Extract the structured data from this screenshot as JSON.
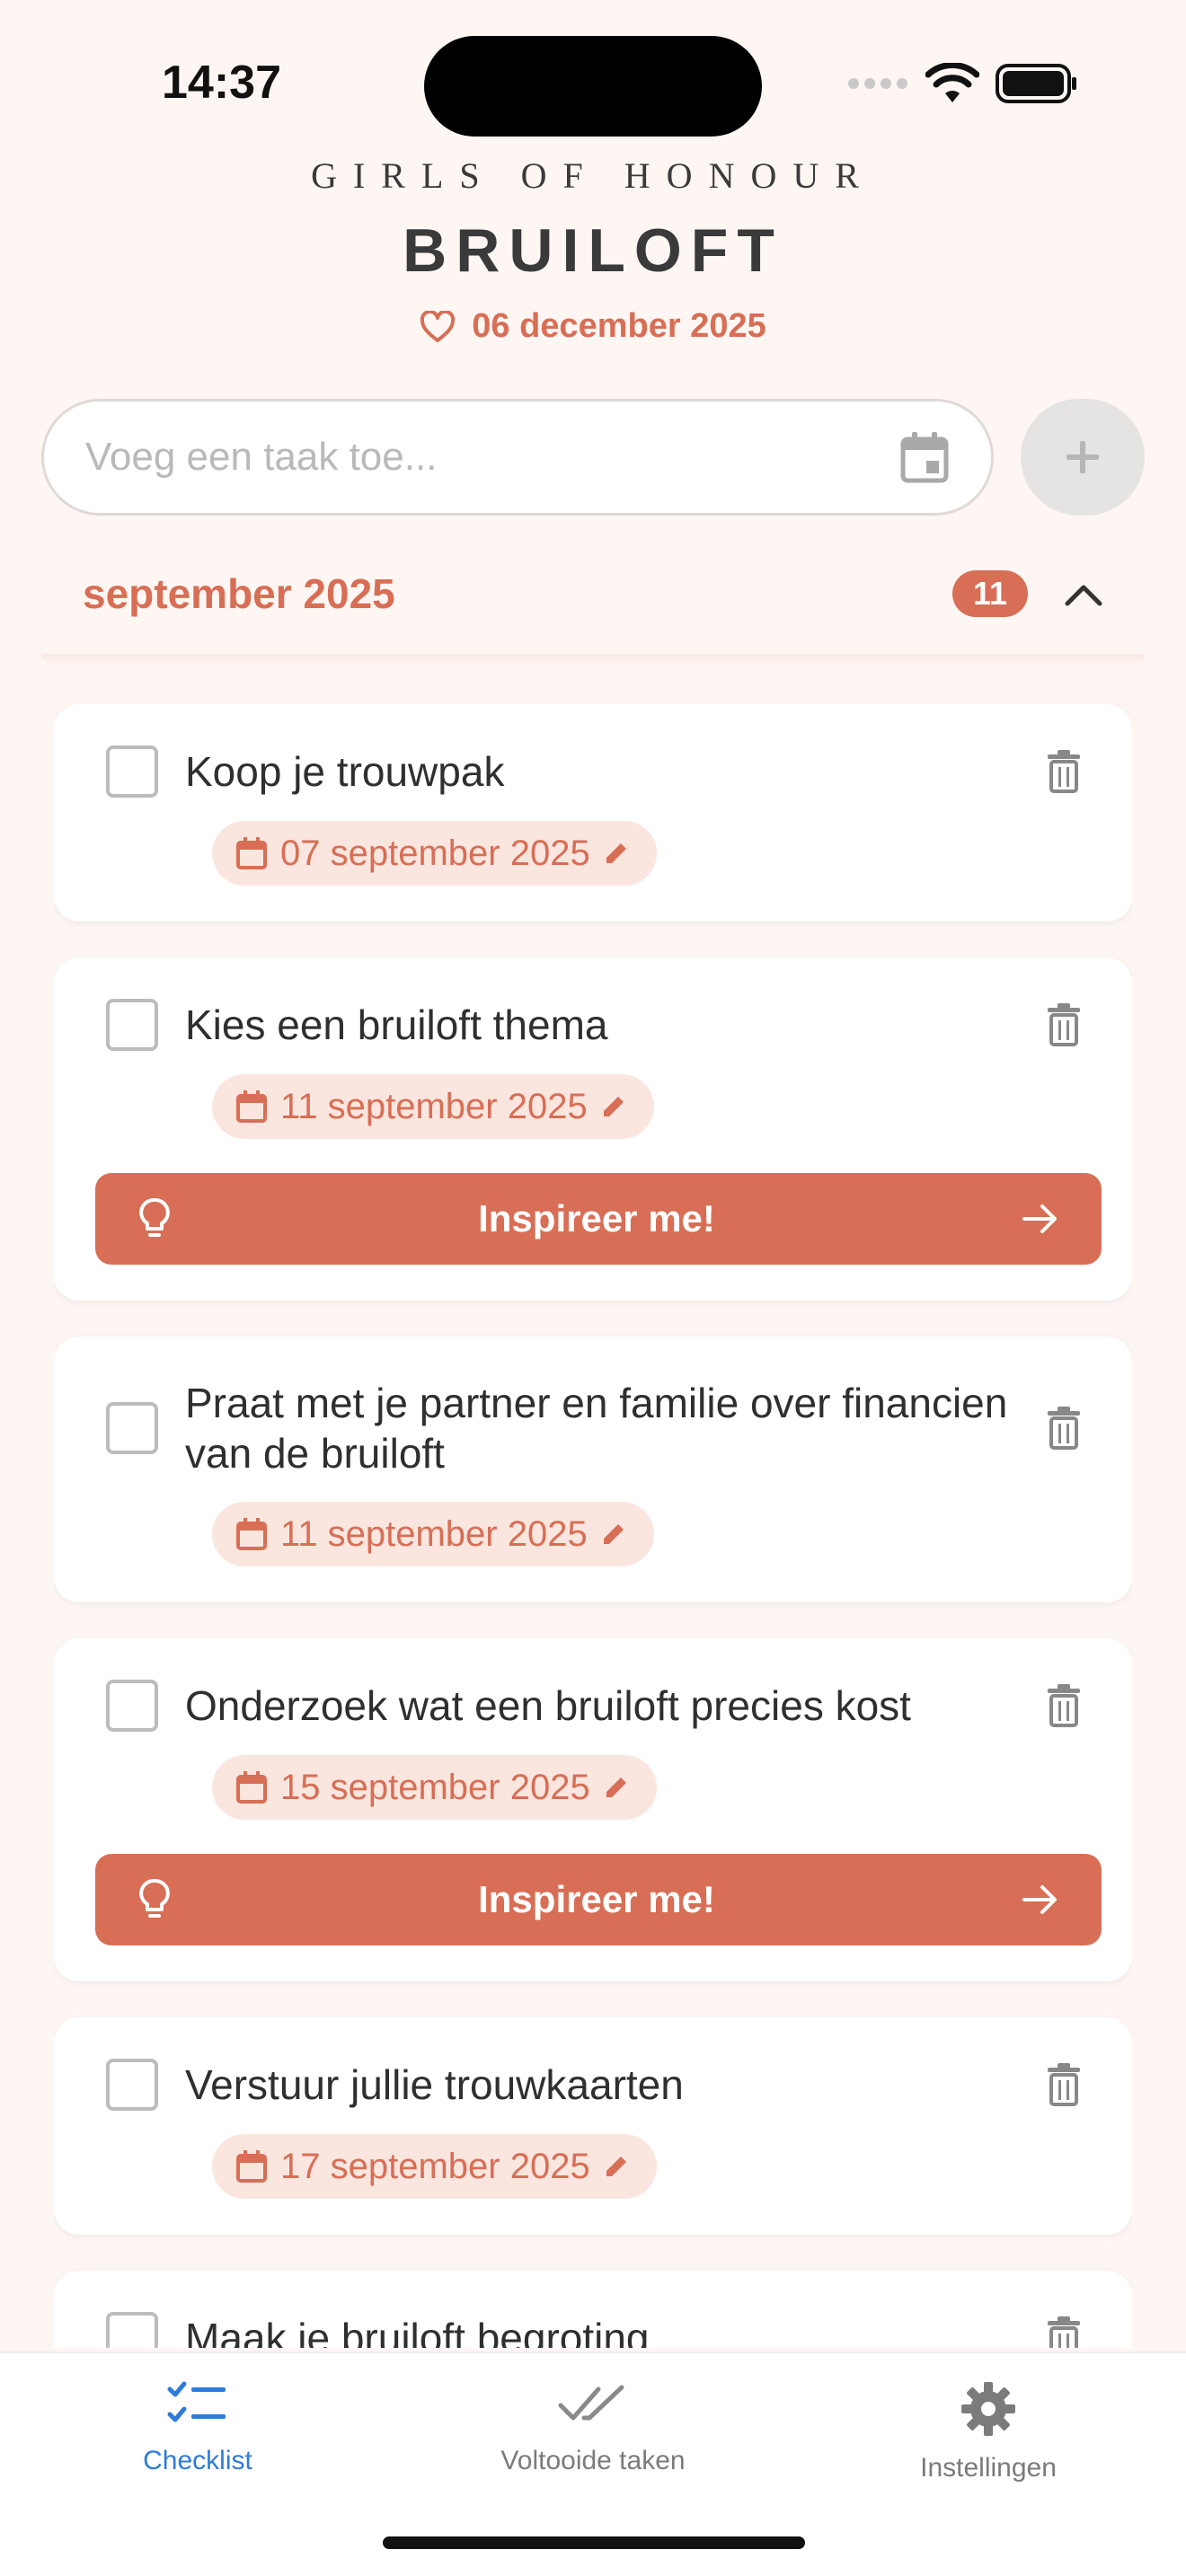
{
  "status_bar": {
    "time": "14:37"
  },
  "header": {
    "brand": "GIRLS OF HONOUR",
    "title": "BRUILOFT",
    "date": "06 december 2025"
  },
  "add_task": {
    "placeholder": "Voeg een taak toe..."
  },
  "month": {
    "label": "september 2025",
    "count": "11"
  },
  "tasks": [
    {
      "title": "Koop je trouwpak",
      "date": "07 september 2025"
    },
    {
      "title": "Kies een bruiloft thema",
      "date": "11 september 2025",
      "inspire": "Inspireer me!"
    },
    {
      "title": "Praat met je partner en familie over financien van de bruiloft",
      "date": "11 september 2025"
    },
    {
      "title": "Onderzoek wat een bruiloft precies kost",
      "date": "15 september 2025",
      "inspire": "Inspireer me!"
    },
    {
      "title": "Verstuur jullie trouwkaarten",
      "date": "17 september 2025"
    },
    {
      "title": "Maak je bruiloft begroting",
      "date": ""
    }
  ],
  "tabbar": {
    "checklist": "Checklist",
    "completed": "Voltooide taken",
    "settings": "Instellingen"
  },
  "colors": {
    "accent": "#d86e55",
    "tab_active": "#2f7bd9",
    "background": "#fdf6f3"
  }
}
